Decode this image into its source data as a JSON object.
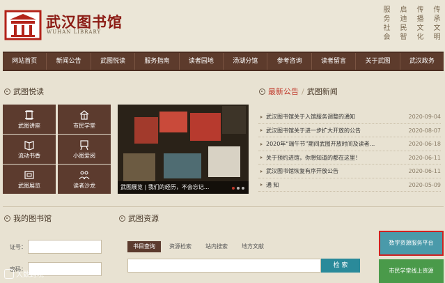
{
  "header": {
    "title_cn": "武汉图书馆",
    "title_en": "WUHAN LIBRARY",
    "slogans": [
      "传承文明",
      "传播文化",
      "启迪民智",
      "服务社会"
    ]
  },
  "nav": {
    "items": [
      "网站首页",
      "新闻公告",
      "武图悦读",
      "服务指南",
      "读者园地",
      "汤湖分馆",
      "参考咨询",
      "读者留言",
      "关于武图",
      "武汉政务"
    ]
  },
  "reading": {
    "title": "武图悦读",
    "tiles": [
      {
        "label": "武图讲座",
        "icon": "scroll-icon"
      },
      {
        "label": "市民学堂",
        "icon": "house-icon"
      },
      {
        "label": "流动书香",
        "icon": "book-icon"
      },
      {
        "label": "小图爱阅",
        "icon": "easel-icon"
      },
      {
        "label": "武图展览",
        "icon": "frame-icon"
      },
      {
        "label": "读者沙龙",
        "icon": "people-icon"
      }
    ],
    "caption": "武图展览 | 我们的经历，不会忘记..."
  },
  "news": {
    "title_a": "最新公告",
    "separator": "/",
    "title_b": "武图新闻",
    "items": [
      {
        "title": "武汉图书馆关于入馆服务调整的通知",
        "date": "2020-09-04"
      },
      {
        "title": "武汉图书馆关于进一步扩大开放的公告",
        "date": "2020-08-07"
      },
      {
        "title": "2020年“端午节”期间武图开放时间及读者...",
        "date": "2020-06-18"
      },
      {
        "title": "关于预约进馆，你想知道的都在这里！",
        "date": "2020-06-11"
      },
      {
        "title": "武汉图书馆恢复有序开放公告",
        "date": "2020-06-11"
      },
      {
        "title": "通 知",
        "date": "2020-05-09"
      }
    ]
  },
  "mylib": {
    "title": "我的图书馆",
    "card_label": "证号：",
    "password_label": "密码："
  },
  "resources": {
    "title": "武图资源",
    "tabs": [
      "书目查询",
      "资源检索",
      "站内搜索",
      "地方文献"
    ],
    "search_button": "检 索"
  },
  "side_buttons": {
    "digital": "数字资源服务平台",
    "online": "市民学堂线上资源"
  },
  "watermark": "大数跨境",
  "colors": {
    "nav_bg": "#5d3b2c",
    "brand_red": "#8b1b14",
    "accent_red": "#c0392b",
    "teal": "#2a8a9a",
    "green": "#4a9a4a"
  }
}
